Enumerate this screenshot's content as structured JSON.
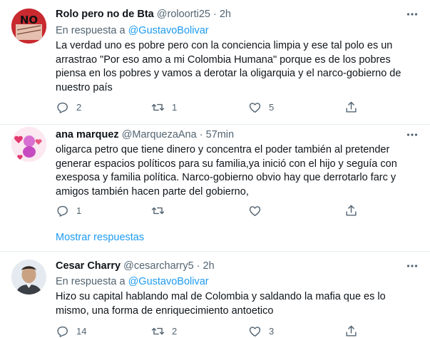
{
  "tweets": [
    {
      "name": "Rolo pero no de Bta",
      "handle": "@roloorti25",
      "sep": "·",
      "time": "2h",
      "reply_label": "En respuesta a",
      "reply_handle": "@GustavoBolivar",
      "text": "La verdad uno es pobre pero con la conciencia limpia y ese tal polo es un arrastrao \"Por eso amo a mi Colombia Humana\" porque es de los pobres piensa en los pobres y vamos a derotar la oligarquia y el narco-gobierno de nuestro país",
      "avatar_text": "NO",
      "replies": "2",
      "retweets": "1",
      "likes": "5"
    },
    {
      "name": "ana marquez",
      "handle": "@MarquezaAna",
      "sep": "·",
      "time": "57min",
      "text": "oligarca petro que tiene dinero y concentra el poder también al pretender generar espacios políticos para su familia,ya inició con el hijo y seguía con exesposa y familia política. Narco-gobierno obvio hay que derrotarlo farc y amigos también hacen parte del gobierno,",
      "replies": "1",
      "retweets": "",
      "likes": ""
    },
    {
      "name": "Cesar Charry",
      "handle": "@cesarcharry5",
      "sep": "·",
      "time": "2h",
      "reply_label": "En respuesta a",
      "reply_handle": "@GustavoBolivar",
      "text": "Hizo su capital hablando mal de Colombia y saldando la mafia que es lo mismo, una forma de enriquecimiento antoetico",
      "replies": "14",
      "retweets": "2",
      "likes": "3"
    }
  ],
  "show_replies": "Mostrar respuestas",
  "colors": {
    "accent": "#1d9bf0",
    "muted": "#536471",
    "divider": "#e6ecf0"
  },
  "icons": [
    "reply-icon",
    "retweet-icon",
    "like-icon",
    "share-icon",
    "more-icon"
  ]
}
